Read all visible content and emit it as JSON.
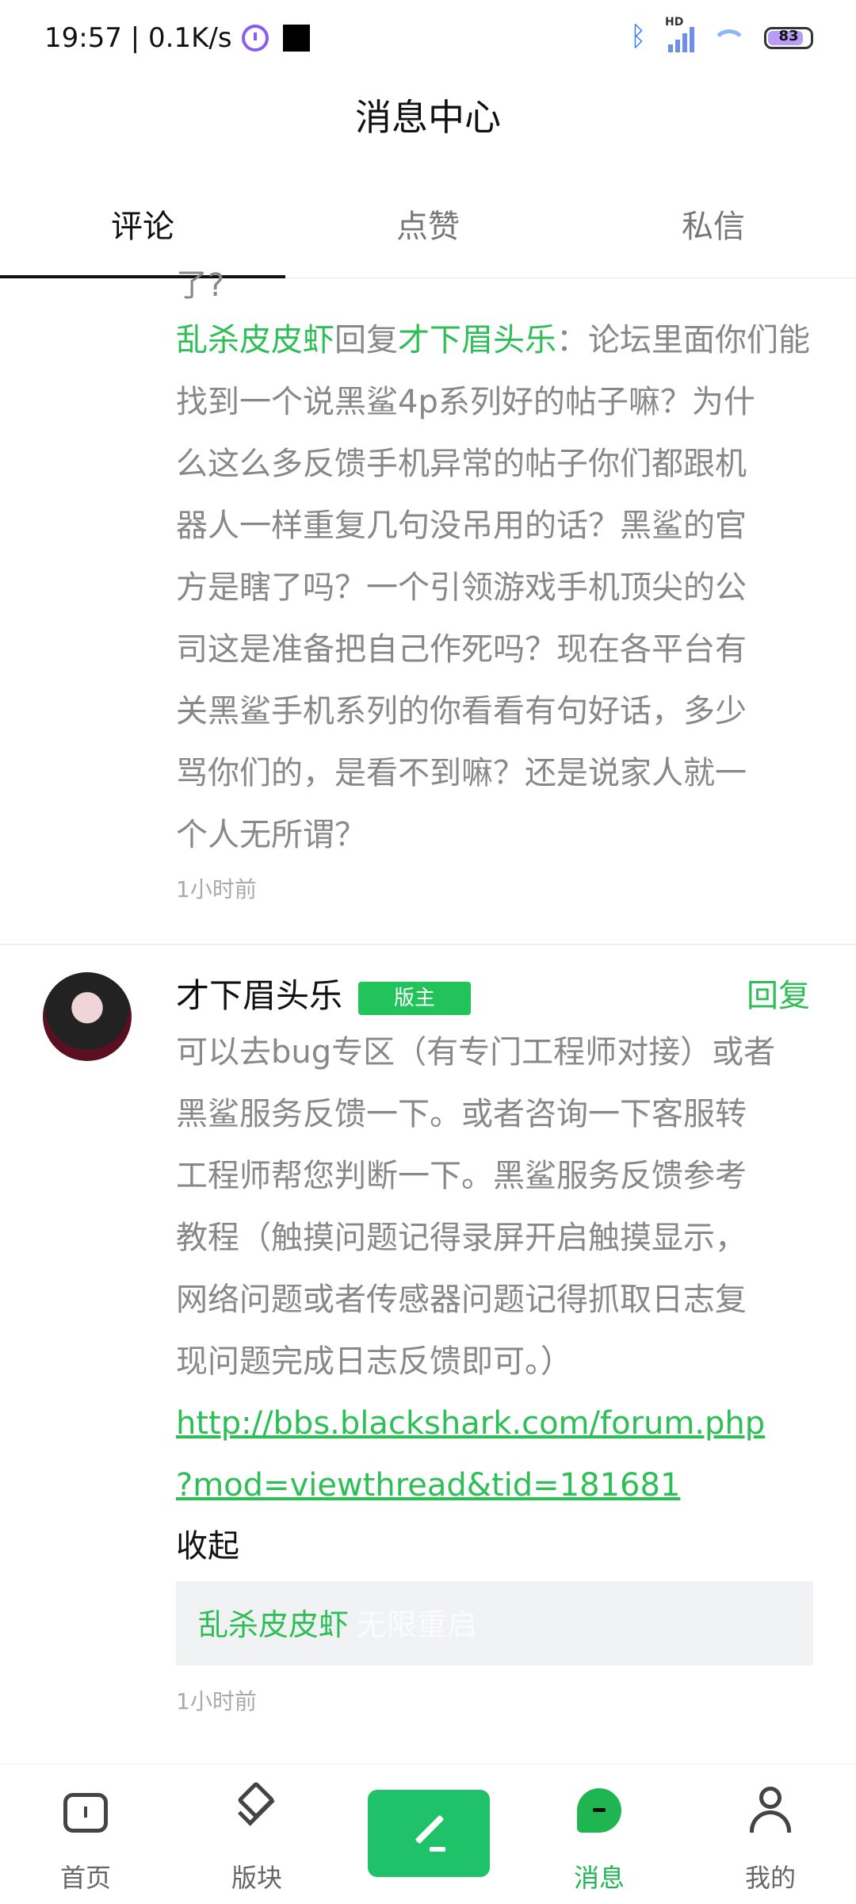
{
  "status_bar": {
    "time_speed": "19:57 | 0.1K/s",
    "network_label": "HD",
    "battery": "83"
  },
  "header": {
    "title": "消息中心"
  },
  "tabs": [
    {
      "label": "评论",
      "active": true
    },
    {
      "label": "点赞",
      "active": false
    },
    {
      "label": "私信",
      "active": false
    }
  ],
  "comment1": {
    "partial_top": "了?",
    "from_user": "乱杀皮皮虾",
    "reply_word": "回复",
    "to_user": "才下眉头乐",
    "text_lines": [
      "：论坛里面你们能",
      "找到一个说黑鲨4p系列好的帖子嘛？为什",
      "么这么多反馈手机异常的帖子你们都跟机",
      "器人一样重复几句没吊用的话？黑鲨的官",
      "方是瞎了吗？一个引领游戏手机顶尖的公",
      "司这是准备把自己作死吗？现在各平台有",
      "关黑鲨手机系列的你看看有句好话，多少",
      "骂你们的，是看不到嘛？还是说家人就一",
      "个人无所谓？"
    ],
    "time": "1小时前"
  },
  "comment2": {
    "username": "才下眉头乐",
    "badge": "版主",
    "reply_button": "回复",
    "text_lines": [
      "可以去bug专区（有专门工程师对接）或者",
      "黑鲨服务反馈一下。或者咨询一下客服转",
      "工程师帮您判断一下。黑鲨服务反馈参考",
      "教程（触摸问题记得录屏开启触摸显示，",
      "网络问题或者传感器问题记得抓取日志复",
      "现问题完成日志反馈即可。）"
    ],
    "url_lines": [
      "http://bbs.blackshark.com/forum.php",
      "?mod=viewthread&tid=181681"
    ],
    "collapse": "收起",
    "quote_user": "乱杀皮皮虾",
    "quote_text": "无限重启",
    "time": "1小时前"
  },
  "bottom_nav": [
    {
      "label": "首页",
      "icon": "home-icon"
    },
    {
      "label": "版块",
      "icon": "layers-icon"
    },
    {
      "label": "",
      "icon": "compose-icon"
    },
    {
      "label": "消息",
      "icon": "message-icon",
      "active": true
    },
    {
      "label": "我的",
      "icon": "user-icon"
    }
  ],
  "colors": {
    "accent": "#2dbf56",
    "badge": "#21c35a",
    "compose": "#1fc268"
  }
}
